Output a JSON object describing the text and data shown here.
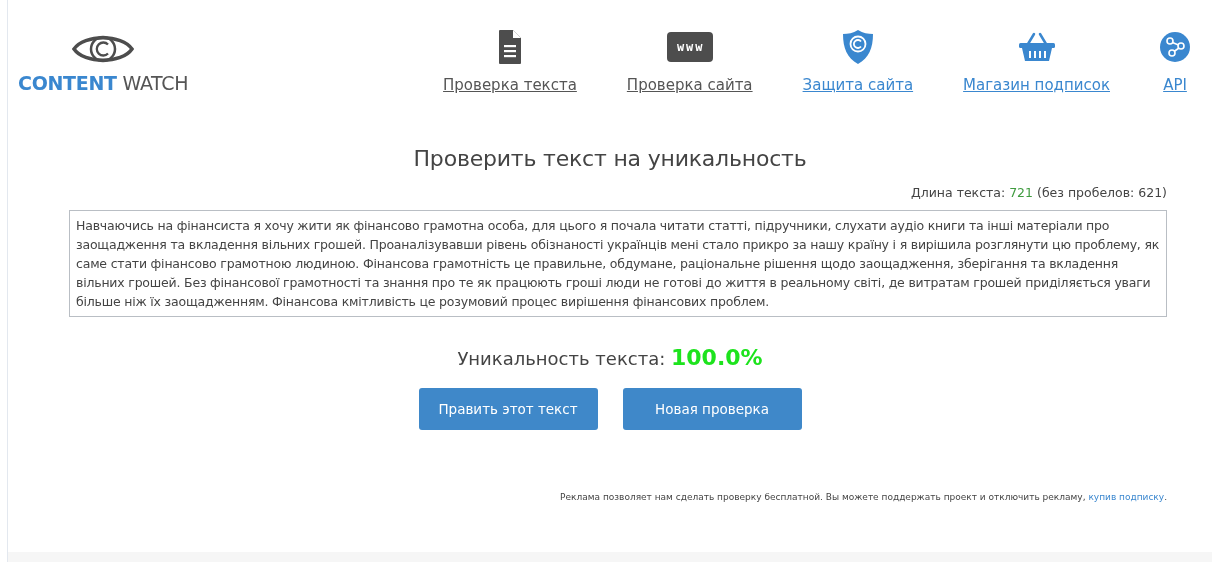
{
  "logo": {
    "word_1": "CONTENT",
    "word_2": "WATCH"
  },
  "nav": [
    {
      "kind": "document",
      "label": "Проверка текста",
      "color": "#555555"
    },
    {
      "kind": "www",
      "label": "Проверка сайта",
      "color": "#555555",
      "icon_text": "www"
    },
    {
      "kind": "shield",
      "label": "Защита сайта",
      "color": "#3a87cf"
    },
    {
      "kind": "basket",
      "label": "Магазин подписок",
      "color": "#3a87cf"
    },
    {
      "kind": "nodes",
      "label": "API",
      "color": "#3a87cf"
    }
  ],
  "title": "Проверить текст на уникальность",
  "length": {
    "label": "Длина текста:",
    "value": "721",
    "note": "(без пробелов: 621)"
  },
  "text": "Навчаючись на фінансиста я хочу жити як фінансово грамотна особа, для цього я почала читати статті, підручники, слухати аудіо книги та інші матеріали про заощадження та вкладення вільних грошей. Проаналізувавши рівень обізнаності українців мені стало прикро за нашу країну і я вирішила розглянути цю проблему, як саме стати фінансово грамотною людиною. Фінансова грамотність це правильне, обдумане, раціональне рішення щодо заощадження, зберігання та вкладення вільних грошей. Без фінансової грамотності та знання про те як працюють гроші люди не готові до життя в реальному світі, де витратам грошей приділяється уваги більше ніж їх заощадженням. Фінансова кмітливість це розумовий процес вирішення фінансових проблем.",
  "uniqueness": {
    "label": "Уникальность текста:",
    "value": "100.0%"
  },
  "buttons": [
    "Править этот текст",
    "Новая проверка"
  ],
  "footer": {
    "text": "Реклама позволяет нам сделать проверку бесплатной. Вы можете поддержать проект и отключить рекламу,",
    "link": "купив подписку",
    "suffix": "."
  }
}
